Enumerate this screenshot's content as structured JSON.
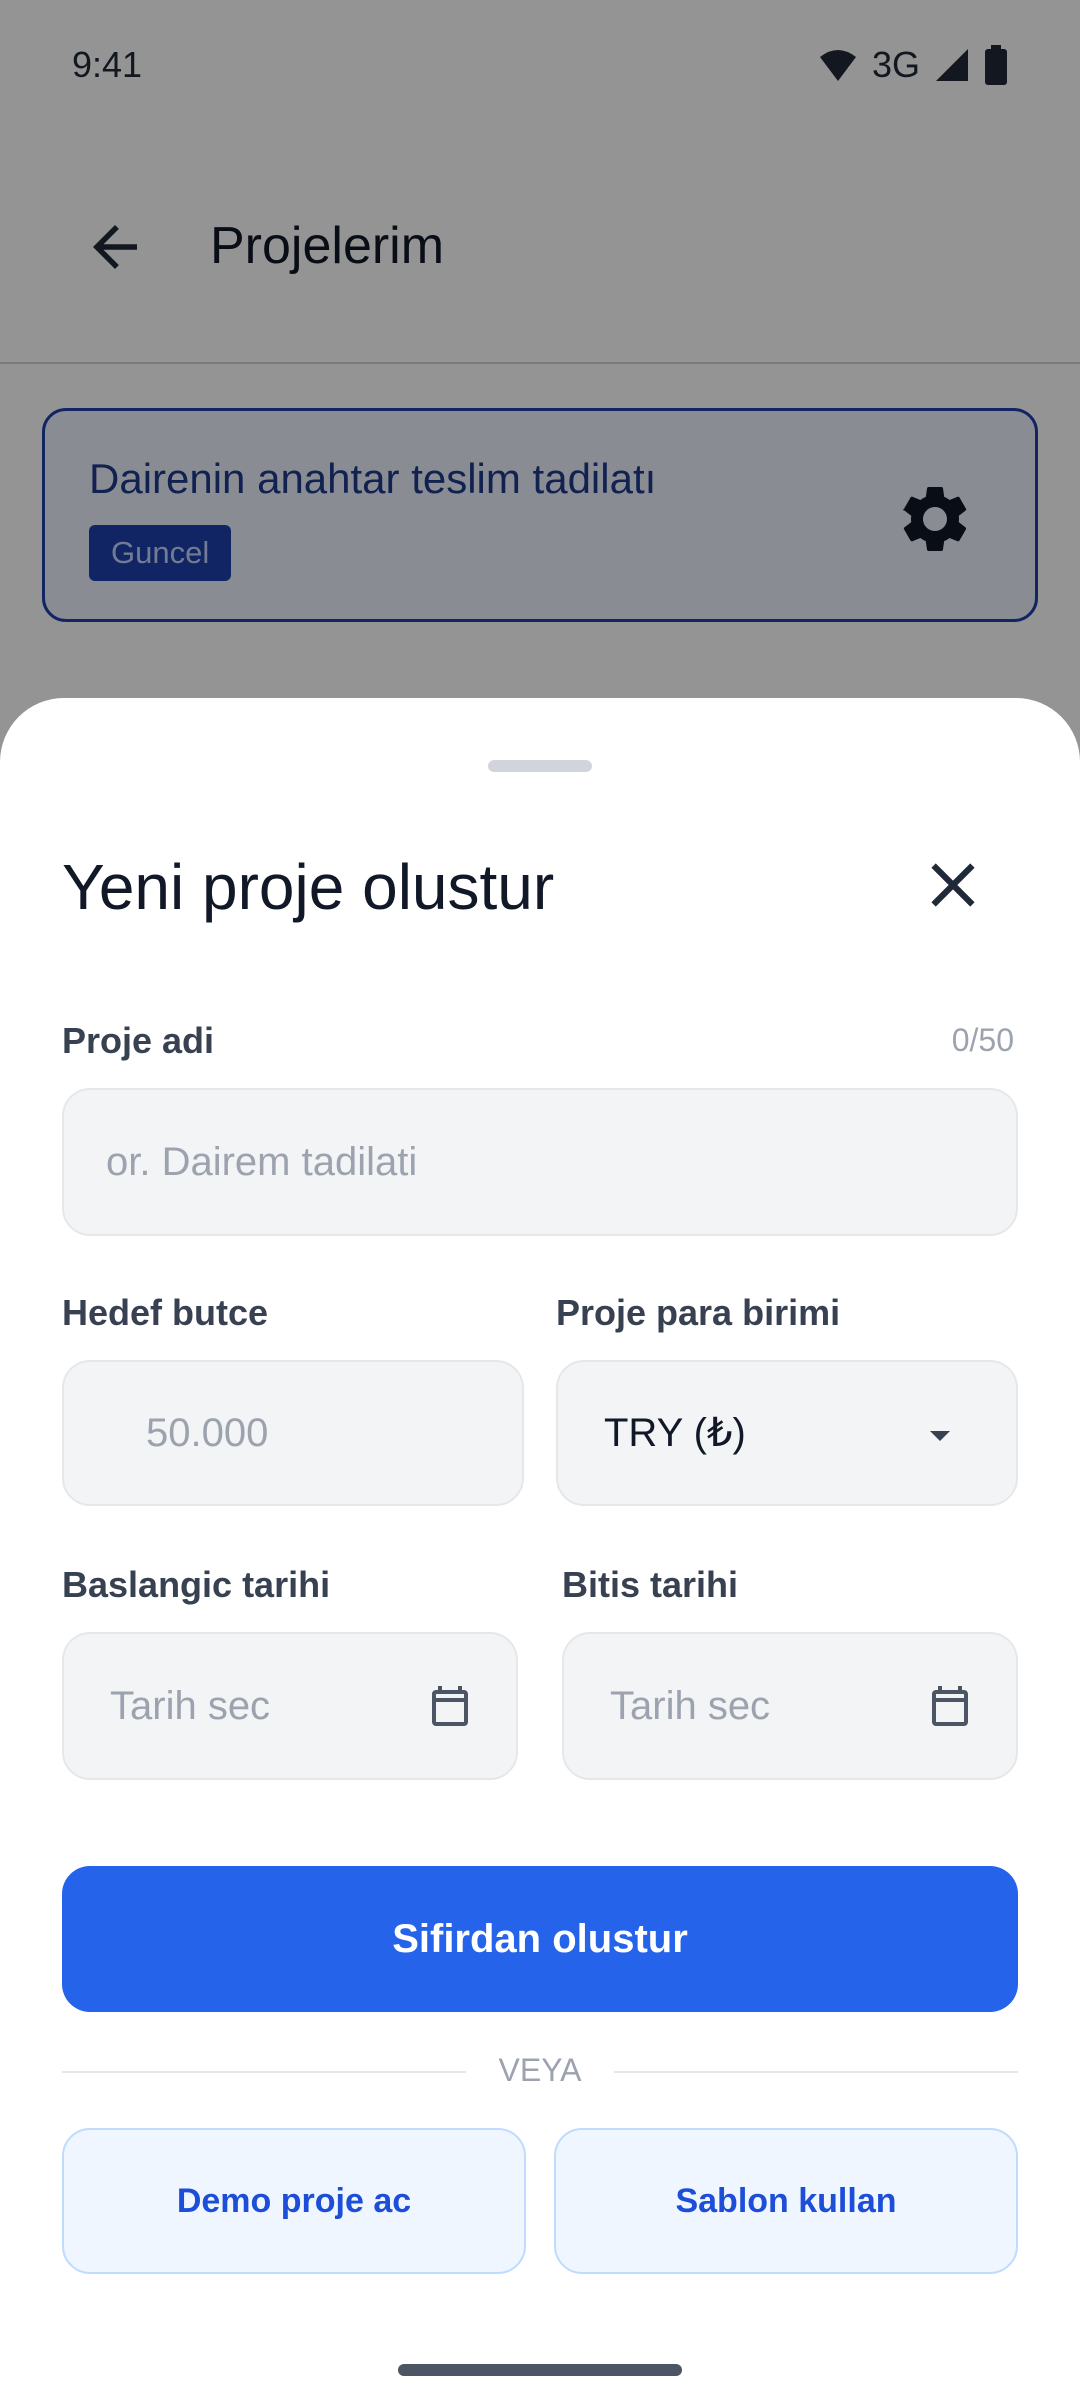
{
  "status_bar": {
    "time": "9:41",
    "network": "3G"
  },
  "app_bar": {
    "title": "Projelerim"
  },
  "project_card": {
    "name": "Dairenin anahtar teslim tadilatı",
    "badge": "Guncel"
  },
  "sheet": {
    "title": "Yeni proje olustur",
    "project_name": {
      "label": "Proje adi",
      "counter": "0/50",
      "placeholder": "or. Dairem tadilati",
      "value": ""
    },
    "budget": {
      "label": "Hedef butce",
      "placeholder": "50.000",
      "value": ""
    },
    "currency": {
      "label": "Proje para birimi",
      "selected": "TRY (₺)"
    },
    "start_date": {
      "label": "Baslangic tarihi",
      "placeholder": "Tarih sec"
    },
    "end_date": {
      "label": "Bitis tarihi",
      "placeholder": "Tarih sec"
    },
    "create_button": "Sifirdan olustur",
    "divider": "VEYA",
    "demo_button": "Demo proje ac",
    "template_button": "Sablon kullan"
  },
  "icons": {
    "back": "arrow-left-icon",
    "settings": "gear-icon",
    "close": "close-icon",
    "dropdown": "triangle-down-icon",
    "calendar": "calendar-icon"
  },
  "colors": {
    "primary": "#2563eb",
    "card_border": "#1e40af",
    "scrim": "rgba(0,0,0,0.42)"
  }
}
